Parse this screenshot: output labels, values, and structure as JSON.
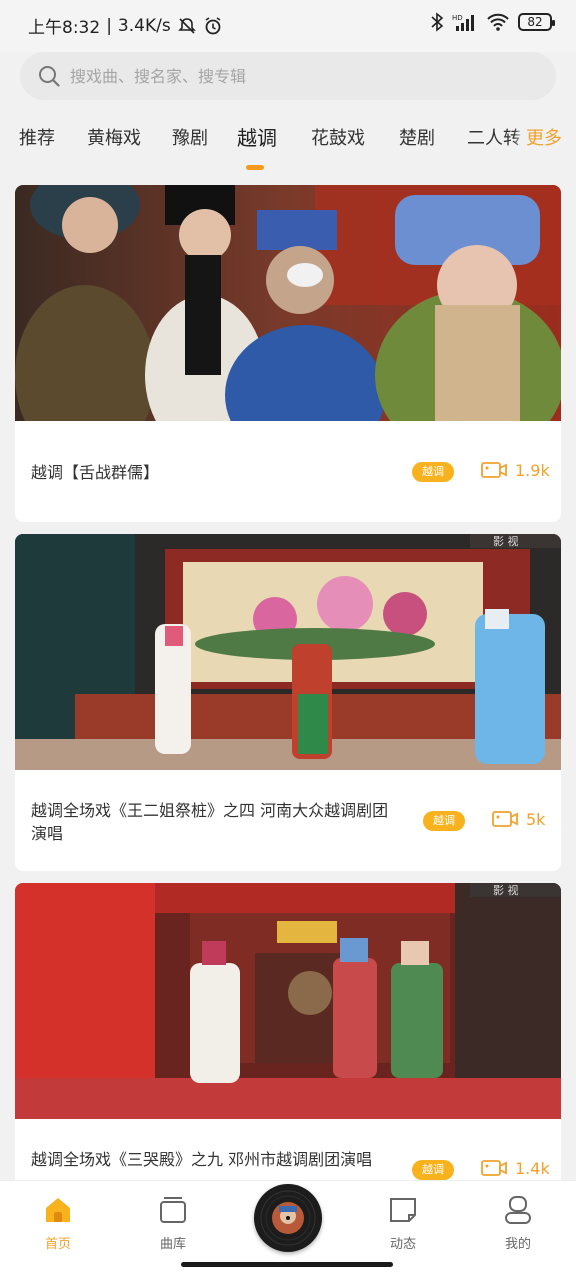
{
  "status_bar": {
    "time": "上午8:32",
    "net_speed": "3.4K/s",
    "battery": "82"
  },
  "search": {
    "placeholder": "搜戏曲、搜名家、搜专辑"
  },
  "tabs": [
    {
      "label": "推荐"
    },
    {
      "label": "黄梅戏"
    },
    {
      "label": "豫剧"
    },
    {
      "label": "越调",
      "active": true
    },
    {
      "label": "花鼓戏"
    },
    {
      "label": "楚剧"
    },
    {
      "label": "二人转"
    }
  ],
  "more_label": "更多",
  "videos": [
    {
      "title": "越调【舌战群儒】",
      "tag": "越调",
      "views": "1.9k"
    },
    {
      "title": "越调全场戏《王二姐祭桩》之四  河南大众越调剧团演唱",
      "tag": "越调",
      "views": "5k",
      "watermark": "影 视"
    },
    {
      "title": "越调全场戏《三哭殿》之九  邓州市越调剧团演唱",
      "tag": "越调",
      "views": "1.4k",
      "watermark": "影 视"
    }
  ],
  "bottom_nav": [
    {
      "label": "首页",
      "icon": "home-icon",
      "active": true
    },
    {
      "label": "曲库",
      "icon": "library-icon"
    },
    {
      "label": "动态",
      "icon": "feed-icon"
    },
    {
      "label": "我的",
      "icon": "profile-icon"
    }
  ],
  "colors": {
    "accent": "#f39a1e",
    "tag_bg": "#f7b21e",
    "views": "#f0a22d"
  }
}
